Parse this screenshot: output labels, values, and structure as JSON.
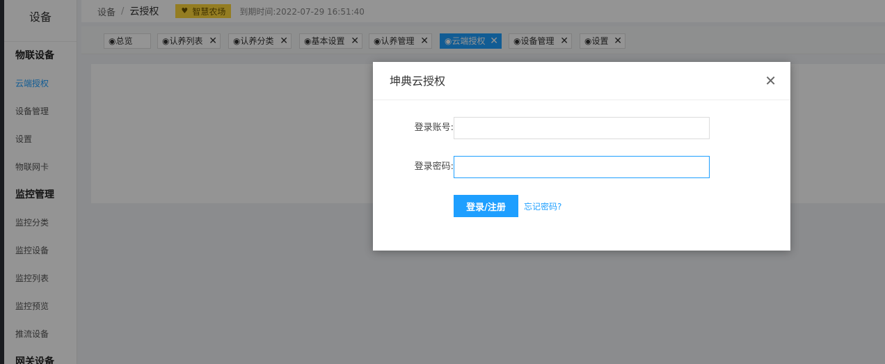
{
  "sidebar": {
    "title": "设备",
    "groups": [
      {
        "header": "物联设备",
        "items": [
          {
            "label": "云端授权",
            "active": true
          },
          {
            "label": "设备管理"
          },
          {
            "label": "设置"
          },
          {
            "label": "物联网卡"
          }
        ]
      },
      {
        "header": "监控管理",
        "items": [
          {
            "label": "监控分类"
          },
          {
            "label": "监控设备"
          },
          {
            "label": "监控列表"
          },
          {
            "label": "监控预览"
          },
          {
            "label": "推流设备"
          }
        ]
      },
      {
        "header": "网关设备",
        "items": []
      }
    ]
  },
  "breadcrumb": {
    "root": "设备",
    "separator": "/",
    "current": "云授权"
  },
  "farm_badge": {
    "label": "智慧农场",
    "icon": "heart-icon"
  },
  "expire": {
    "label": "到期时间:",
    "value": "2022-07-29 16:51:40"
  },
  "tabs": [
    {
      "label": "◉总览",
      "closable": false
    },
    {
      "label": "◉认养列表",
      "closable": true
    },
    {
      "label": "◉认养分类",
      "closable": true
    },
    {
      "label": "◉基本设置",
      "closable": true
    },
    {
      "label": "◉认养管理",
      "closable": true
    },
    {
      "label": "◉云端授权",
      "closable": true,
      "active": true
    },
    {
      "label": "◉设备管理",
      "closable": true
    },
    {
      "label": "◉设置",
      "closable": true
    }
  ],
  "modal": {
    "title": "坤典云授权",
    "close_icon": "close-icon",
    "account_label": "登录账号:",
    "account_value": "",
    "password_label": "登录密码:",
    "password_value": "",
    "submit_label": "登录/注册",
    "forgot_label": "忘记密码?"
  },
  "colors": {
    "accent": "#1e9fff",
    "badge": "#ffd83b",
    "overlay": "rgba(0,0,0,0.42)"
  }
}
